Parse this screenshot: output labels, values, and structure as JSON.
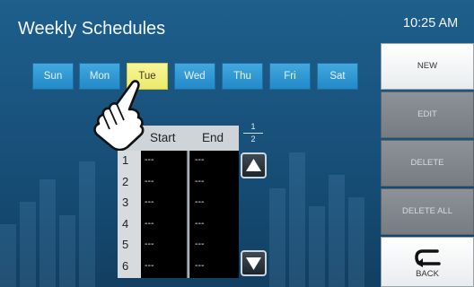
{
  "header": {
    "title": "Weekly Schedules",
    "time": "10:25 AM"
  },
  "days": [
    {
      "label": "Sun",
      "active": false
    },
    {
      "label": "Mon",
      "active": false
    },
    {
      "label": "Tue",
      "active": true
    },
    {
      "label": "Wed",
      "active": false
    },
    {
      "label": "Thu",
      "active": false
    },
    {
      "label": "Fri",
      "active": false
    },
    {
      "label": "Sat",
      "active": false
    }
  ],
  "table": {
    "columns": [
      "Start",
      "End"
    ],
    "rows": [
      {
        "num": "1",
        "start": "---",
        "end": "---"
      },
      {
        "num": "2",
        "start": "---",
        "end": "---"
      },
      {
        "num": "3",
        "start": "---",
        "end": "---"
      },
      {
        "num": "4",
        "start": "---",
        "end": "---"
      },
      {
        "num": "5",
        "start": "---",
        "end": "---"
      },
      {
        "num": "6",
        "start": "---",
        "end": "---"
      }
    ]
  },
  "pager": {
    "current": "1",
    "total": "2"
  },
  "actions": {
    "new": "NEW",
    "edit": "EDIT",
    "delete": "DELETE",
    "delete_all": "DELETE ALL",
    "back": "BACK"
  },
  "colors": {
    "background": "#1b5a86",
    "day_tab": "#2f97d4",
    "day_tab_active": "#efed7c",
    "disabled_button": "#81878c"
  },
  "icons": [
    "pointing-hand-icon",
    "arrow-up-icon",
    "arrow-down-icon",
    "back-arrow-icon"
  ]
}
